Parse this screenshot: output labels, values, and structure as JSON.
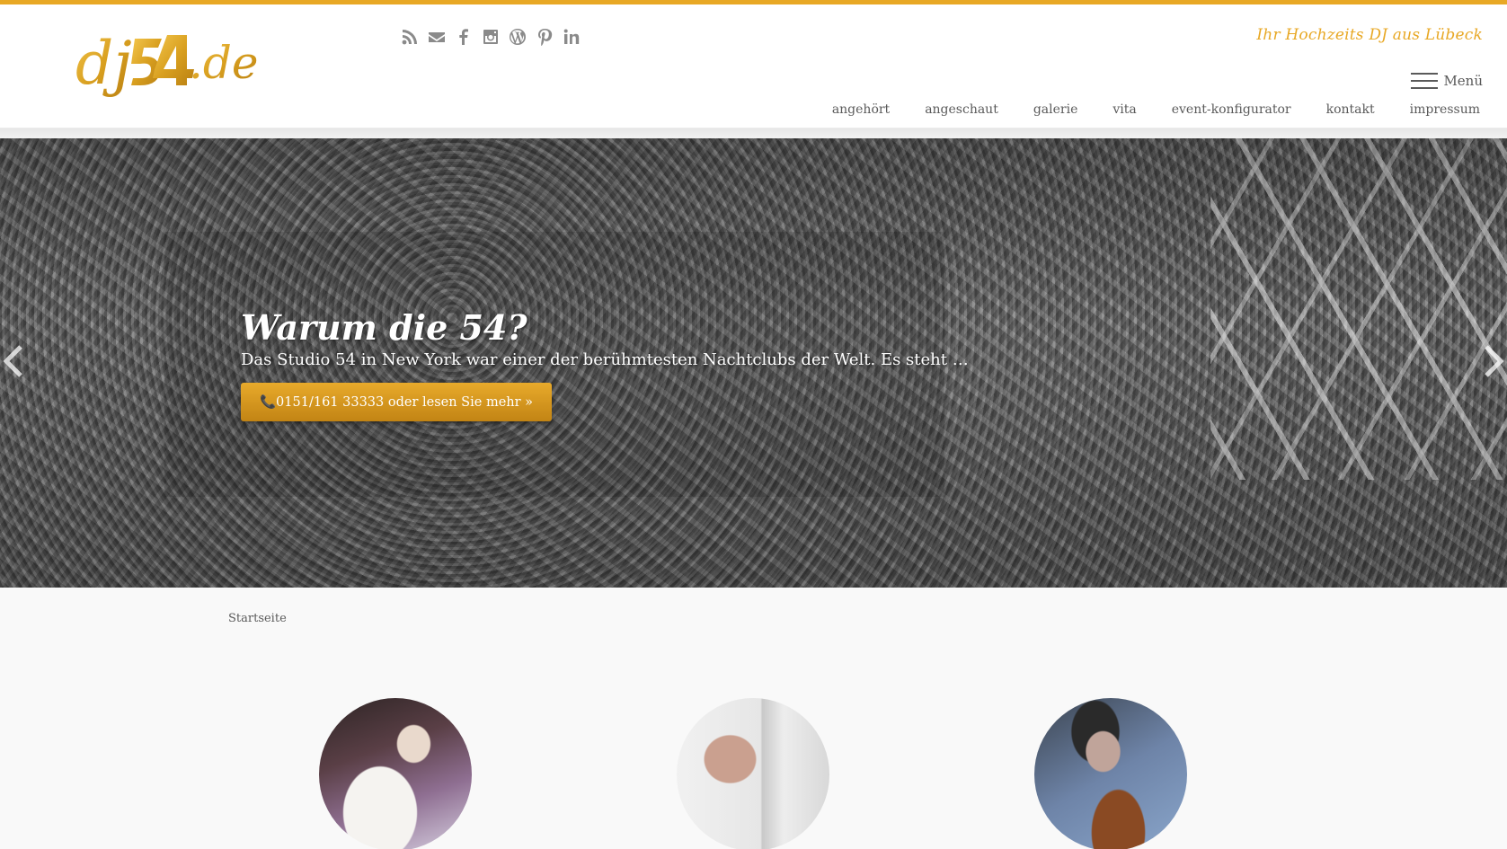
{
  "brand": {
    "logo_text": "dj54.de",
    "tagline": "Ihr Hochzeits DJ aus Lübeck",
    "accent_color": "#e8a825"
  },
  "social_icons": [
    "rss-icon",
    "mail-icon",
    "facebook-icon",
    "instagram-icon",
    "wordpress-icon",
    "pinterest-icon",
    "linkedin-icon"
  ],
  "menu": {
    "label": "Menü"
  },
  "nav": {
    "items": [
      {
        "label": "angehört"
      },
      {
        "label": "angeschaut"
      },
      {
        "label": "galerie"
      },
      {
        "label": "vita"
      },
      {
        "label": "event-konfigurator"
      },
      {
        "label": "kontakt"
      },
      {
        "label": "impressum"
      }
    ]
  },
  "slider": {
    "title": "Warum die 54?",
    "text": "Das Studio 54 in New York war einer der berühmtesten Nachtclubs der Welt. Es steht …",
    "cta_label": "📞0151/161 33333 oder lesen Sie mehr »"
  },
  "breadcrumb": {
    "label": "Startseite"
  },
  "featured": {
    "items": [
      {
        "image": "wedding-couple-photo"
      },
      {
        "image": "hand-holding-card-photo"
      },
      {
        "image": "guitarist-photo"
      }
    ]
  }
}
